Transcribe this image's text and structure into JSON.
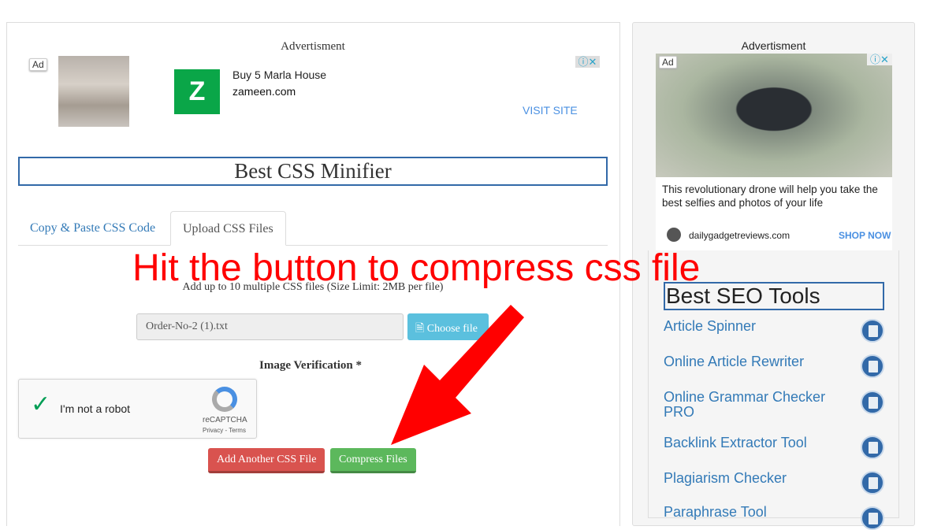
{
  "left_ad": {
    "heading": "Advertisment",
    "ad_badge": "Ad",
    "title": "Buy 5 Marla House",
    "domain": "zameen.com",
    "cta": "VISIT SITE",
    "logo_letter": "Z"
  },
  "page_title": "Best CSS Minifier",
  "tabs": [
    {
      "label": "Copy & Paste CSS Code",
      "active": false
    },
    {
      "label": "Upload CSS Files",
      "active": true
    }
  ],
  "upload": {
    "hint": "Add up to 10 multiple CSS files (Size Limit: 2MB per file)",
    "file_value": "Order-No-2 (1).txt",
    "choose_label": "Choose file"
  },
  "verification": {
    "label": "Image Verification *",
    "captcha_text": "I'm not a robot",
    "captcha_brand": "reCAPTCHA",
    "captcha_links": "Privacy - Terms",
    "checked": true
  },
  "buttons": {
    "add": "Add Another CSS File",
    "compress": "Compress Files"
  },
  "annotation": {
    "text": "Hit the button to compress css file",
    "color": "#ff0000"
  },
  "right_ad": {
    "heading": "Advertisment",
    "ad_badge": "Ad",
    "text": "This revolutionary drone will help you take the best selfies and photos of your life",
    "domain": "dailygadgetreviews.com",
    "cta": "SHOP NOW"
  },
  "seo": {
    "title": "Best SEO Tools",
    "items": [
      {
        "label": "Article Spinner",
        "icon": "spinner-doc-icon"
      },
      {
        "label": "Online Article Rewriter",
        "icon": "rewriter-icon"
      },
      {
        "label": "Online Grammar Checker PRO",
        "icon": "grammar-check-icon"
      },
      {
        "label": "Backlink Extractor Tool",
        "icon": "backlink-icon"
      },
      {
        "label": "Plagiarism Checker",
        "icon": "plagiarism-icon"
      },
      {
        "label": "Paraphrase Tool",
        "icon": "paraphrase-icon"
      }
    ]
  },
  "colors": {
    "accent": "#337ab7",
    "danger": "#d9534f",
    "success": "#5cb85c",
    "info": "#5bc0de"
  }
}
